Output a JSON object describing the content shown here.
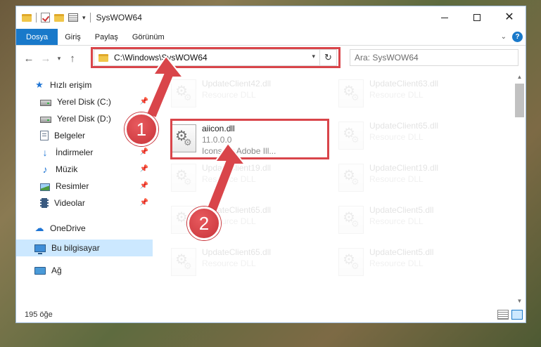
{
  "window": {
    "title": "SysWOW64",
    "buttons": {
      "minimize": "",
      "maximize": "",
      "close": "✕"
    }
  },
  "ribbon": {
    "tabs": [
      "Dosya",
      "Giriş",
      "Paylaş",
      "Görünüm"
    ]
  },
  "nav": {
    "address": "C:\\Windows\\SysWOW64",
    "search_placeholder": "Ara: SysWOW64"
  },
  "sidebar": {
    "quick_access": "Hızlı erişim",
    "items": [
      {
        "label": "Yerel Disk (C:)",
        "icon": "drive-icon",
        "pinned": true
      },
      {
        "label": "Yerel Disk (D:)",
        "icon": "drive-icon",
        "pinned": true
      },
      {
        "label": "Belgeler",
        "icon": "documents-icon",
        "pinned": true
      },
      {
        "label": "İndirmeler",
        "icon": "downloads-icon",
        "pinned": true
      },
      {
        "label": "Müzik",
        "icon": "music-icon",
        "pinned": true
      },
      {
        "label": "Resimler",
        "icon": "pictures-icon",
        "pinned": true
      },
      {
        "label": "Videolar",
        "icon": "videos-icon",
        "pinned": true
      }
    ],
    "onedrive": "OneDrive",
    "this_pc": "Bu bilgisayar",
    "network": "Ağ"
  },
  "files": {
    "highlighted": {
      "name": "aiicon.dll",
      "version": "11.0.0.0",
      "description": "Icons for Adobe Ill..."
    },
    "faded_left": [
      {
        "name": "UpdateClient42.dll",
        "sub": "Resource DLL"
      },
      {
        "name": "UpdateClient19.dll",
        "sub": "Resource DLL"
      },
      {
        "name": "UpdateClient65.dll",
        "sub": "Resource DLL"
      },
      {
        "name": "UpdateClient65.dll",
        "sub": "Resource DLL"
      }
    ],
    "faded_right": [
      {
        "name": "UpdateClient63.dll",
        "sub": "Resource DLL"
      },
      {
        "name": "UpdateClient65.dll",
        "sub": "Resource DLL"
      },
      {
        "name": "UpdateClient19.dll",
        "sub": "Resource DLL"
      },
      {
        "name": "UpdateClient5.dll",
        "sub": "Resource DLL"
      },
      {
        "name": "UpdateClient5.dll",
        "sub": "Resource DLL"
      }
    ]
  },
  "status": {
    "count": "195 öğe"
  },
  "annotations": {
    "step1": "1",
    "step2": "2"
  },
  "colors": {
    "accent": "#1979ca",
    "highlight": "#d9454a",
    "selection": "#cce8ff"
  }
}
